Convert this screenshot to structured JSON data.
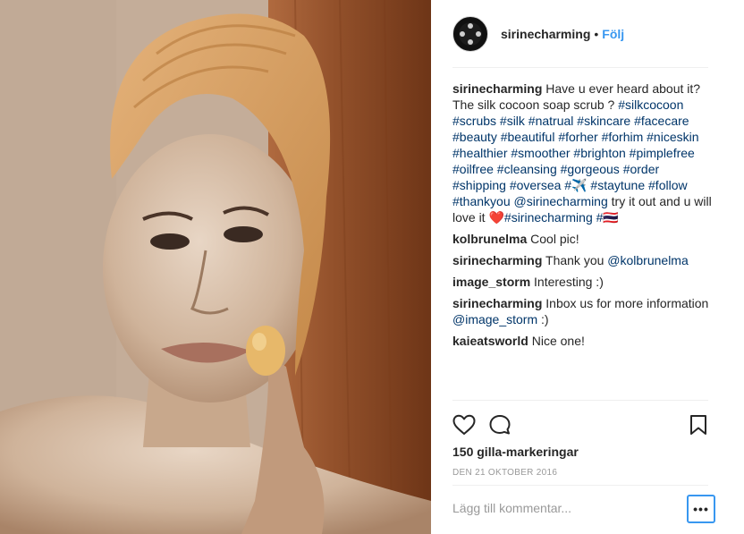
{
  "post": {
    "username": "sirinecharming",
    "dot": "•",
    "follow_label": "Följ"
  },
  "caption": {
    "username": "sirinecharming",
    "text1": " Have u ever heard about it? The silk cocoon soap scrub ? ",
    "hashtags1": "#silkcocoon #scrubs #silk #natrual #skincare #facecare #beauty #beautiful #forher #forhim #niceskin #healthier #smoother #brighton #pimplefree #oilfree #cleansing #gorgeous #order #shipping #oversea #✈️ #staytune #follow #thankyou",
    "mention": "@sirinecharming",
    "text2": " try it out and u will love it ",
    "heart": "❤️",
    "hashtags2": "#sirinecharming #🇹🇭"
  },
  "comments": [
    {
      "username": "kolbrunelma",
      "text": "Cool pic!",
      "mention": "",
      "after": ""
    },
    {
      "username": "sirinecharming",
      "text": "Thank you ",
      "mention": "@kolbrunelma",
      "after": ""
    },
    {
      "username": "image_storm",
      "text": "Interesting :)",
      "mention": "",
      "after": ""
    },
    {
      "username": "sirinecharming",
      "text": "Inbox us for more information ",
      "mention": "@image_storm",
      "after": " :)"
    },
    {
      "username": "kaieatsworld",
      "text": "Nice one!",
      "mention": "",
      "after": ""
    }
  ],
  "actions": {
    "like_icon": "heart-outline-icon",
    "comment_icon": "speech-bubble-icon",
    "save_icon": "bookmark-icon"
  },
  "likes": "150 gilla-markeringar",
  "date": "DEN 21 OKTOBER 2016",
  "add_comment_placeholder": "Lägg till kommentar...",
  "more_label": "•••",
  "colors": {
    "link": "#003569",
    "follow": "#3897f0",
    "focus": "#3897f0"
  }
}
